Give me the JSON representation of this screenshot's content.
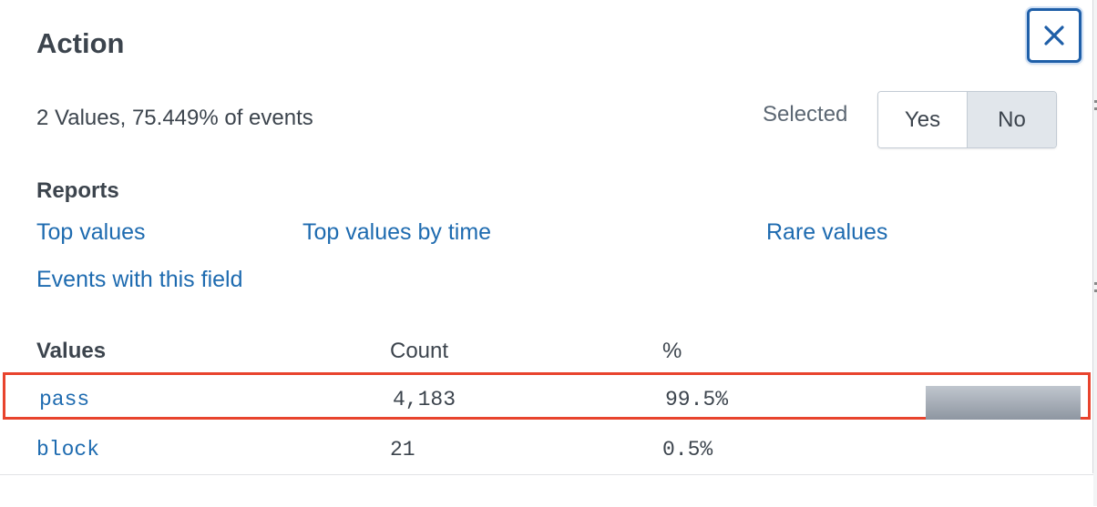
{
  "dialog": {
    "title": "Action",
    "close_icon": "close-icon",
    "summary": "2 Values, 75.449% of events",
    "selected": {
      "label": "Selected",
      "options": [
        "Yes",
        "No"
      ],
      "current": "No"
    }
  },
  "reports": {
    "label": "Reports",
    "links": [
      "Top values",
      "Top values by time",
      "Rare values",
      "Events with this field"
    ]
  },
  "table": {
    "headers": [
      "Values",
      "Count",
      "%"
    ],
    "rows": [
      {
        "value": "pass",
        "count": "4,183",
        "percent": "99.5%",
        "bar_fraction": 0.995,
        "highlighted": true
      },
      {
        "value": "block",
        "count": "21",
        "percent": "0.5%",
        "bar_fraction": 0.005,
        "highlighted": false
      }
    ]
  },
  "colors": {
    "accent": "#1e6bb0",
    "highlight_border": "#e8432d",
    "close_border": "#1f5fa8"
  }
}
